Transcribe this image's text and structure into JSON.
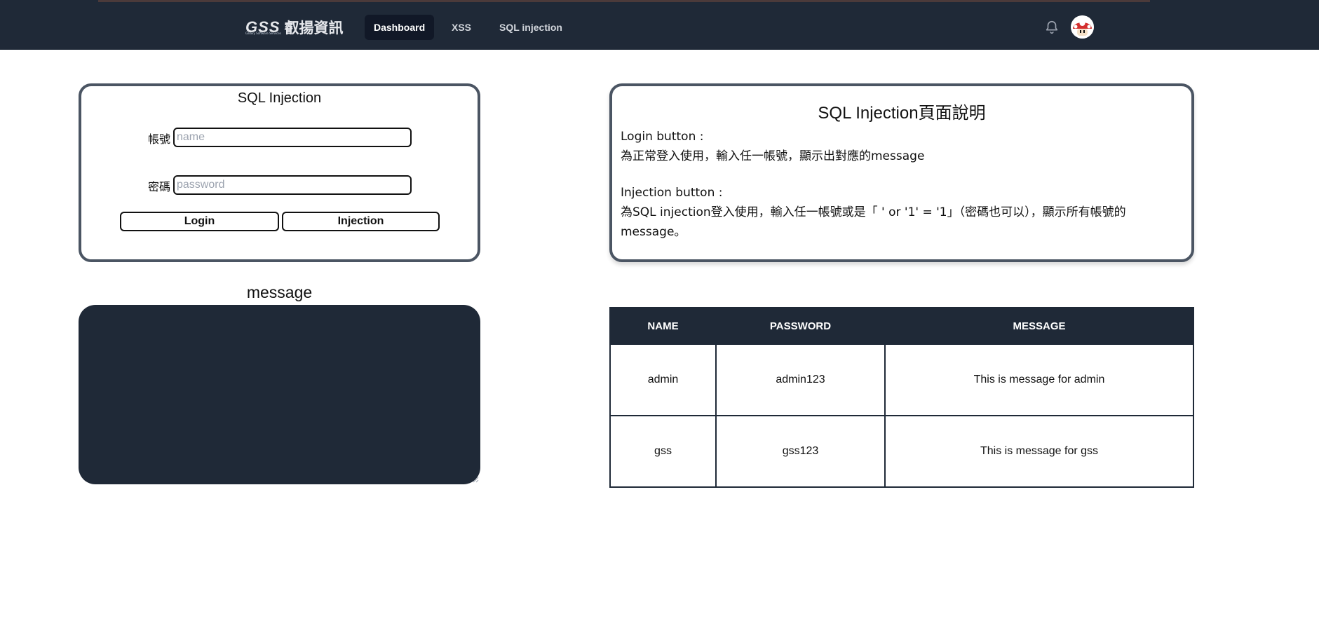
{
  "navbar": {
    "logo_mark": "GSS",
    "logo_sub": "Galaxy Software Services",
    "logo_cn": "叡揚資訊",
    "links": [
      {
        "label": "Dashboard",
        "active": true
      },
      {
        "label": "XSS",
        "active": false
      },
      {
        "label": "SQL injection",
        "active": false
      }
    ],
    "bell_icon": "bell-icon",
    "avatar_icon": "mushroom-avatar"
  },
  "login": {
    "title": "SQL Injection",
    "account_label": "帳號",
    "account_placeholder": "name",
    "account_value": "",
    "password_label": "密碼",
    "password_placeholder": "password",
    "password_value": "",
    "login_button": "Login",
    "injection_button": "Injection"
  },
  "message": {
    "label": "message",
    "content": ""
  },
  "info": {
    "title": "SQL Injection頁面說明",
    "login_heading": "Login button :",
    "login_desc": "為正常登入使用，輸入任一帳號，顯示出對應的message",
    "injection_heading": "Injection button :",
    "injection_desc": "為SQL injection登入使用，輸入任一帳號或是「 ' or '1' = '1」（密碼也可以），顯示所有帳號的message。"
  },
  "table": {
    "headers": [
      "NAME",
      "PASSWORD",
      "MESSAGE"
    ],
    "rows": [
      [
        "admin",
        "admin123",
        "This is message for admin"
      ],
      [
        "gss",
        "gss123",
        "This is message for gss"
      ]
    ]
  },
  "colors": {
    "navbar_bg": "#1f2937",
    "active_link_bg": "#111827",
    "card_border": "#4b5563",
    "message_box_bg": "#1f2937",
    "table_header_bg": "#1f2937"
  }
}
